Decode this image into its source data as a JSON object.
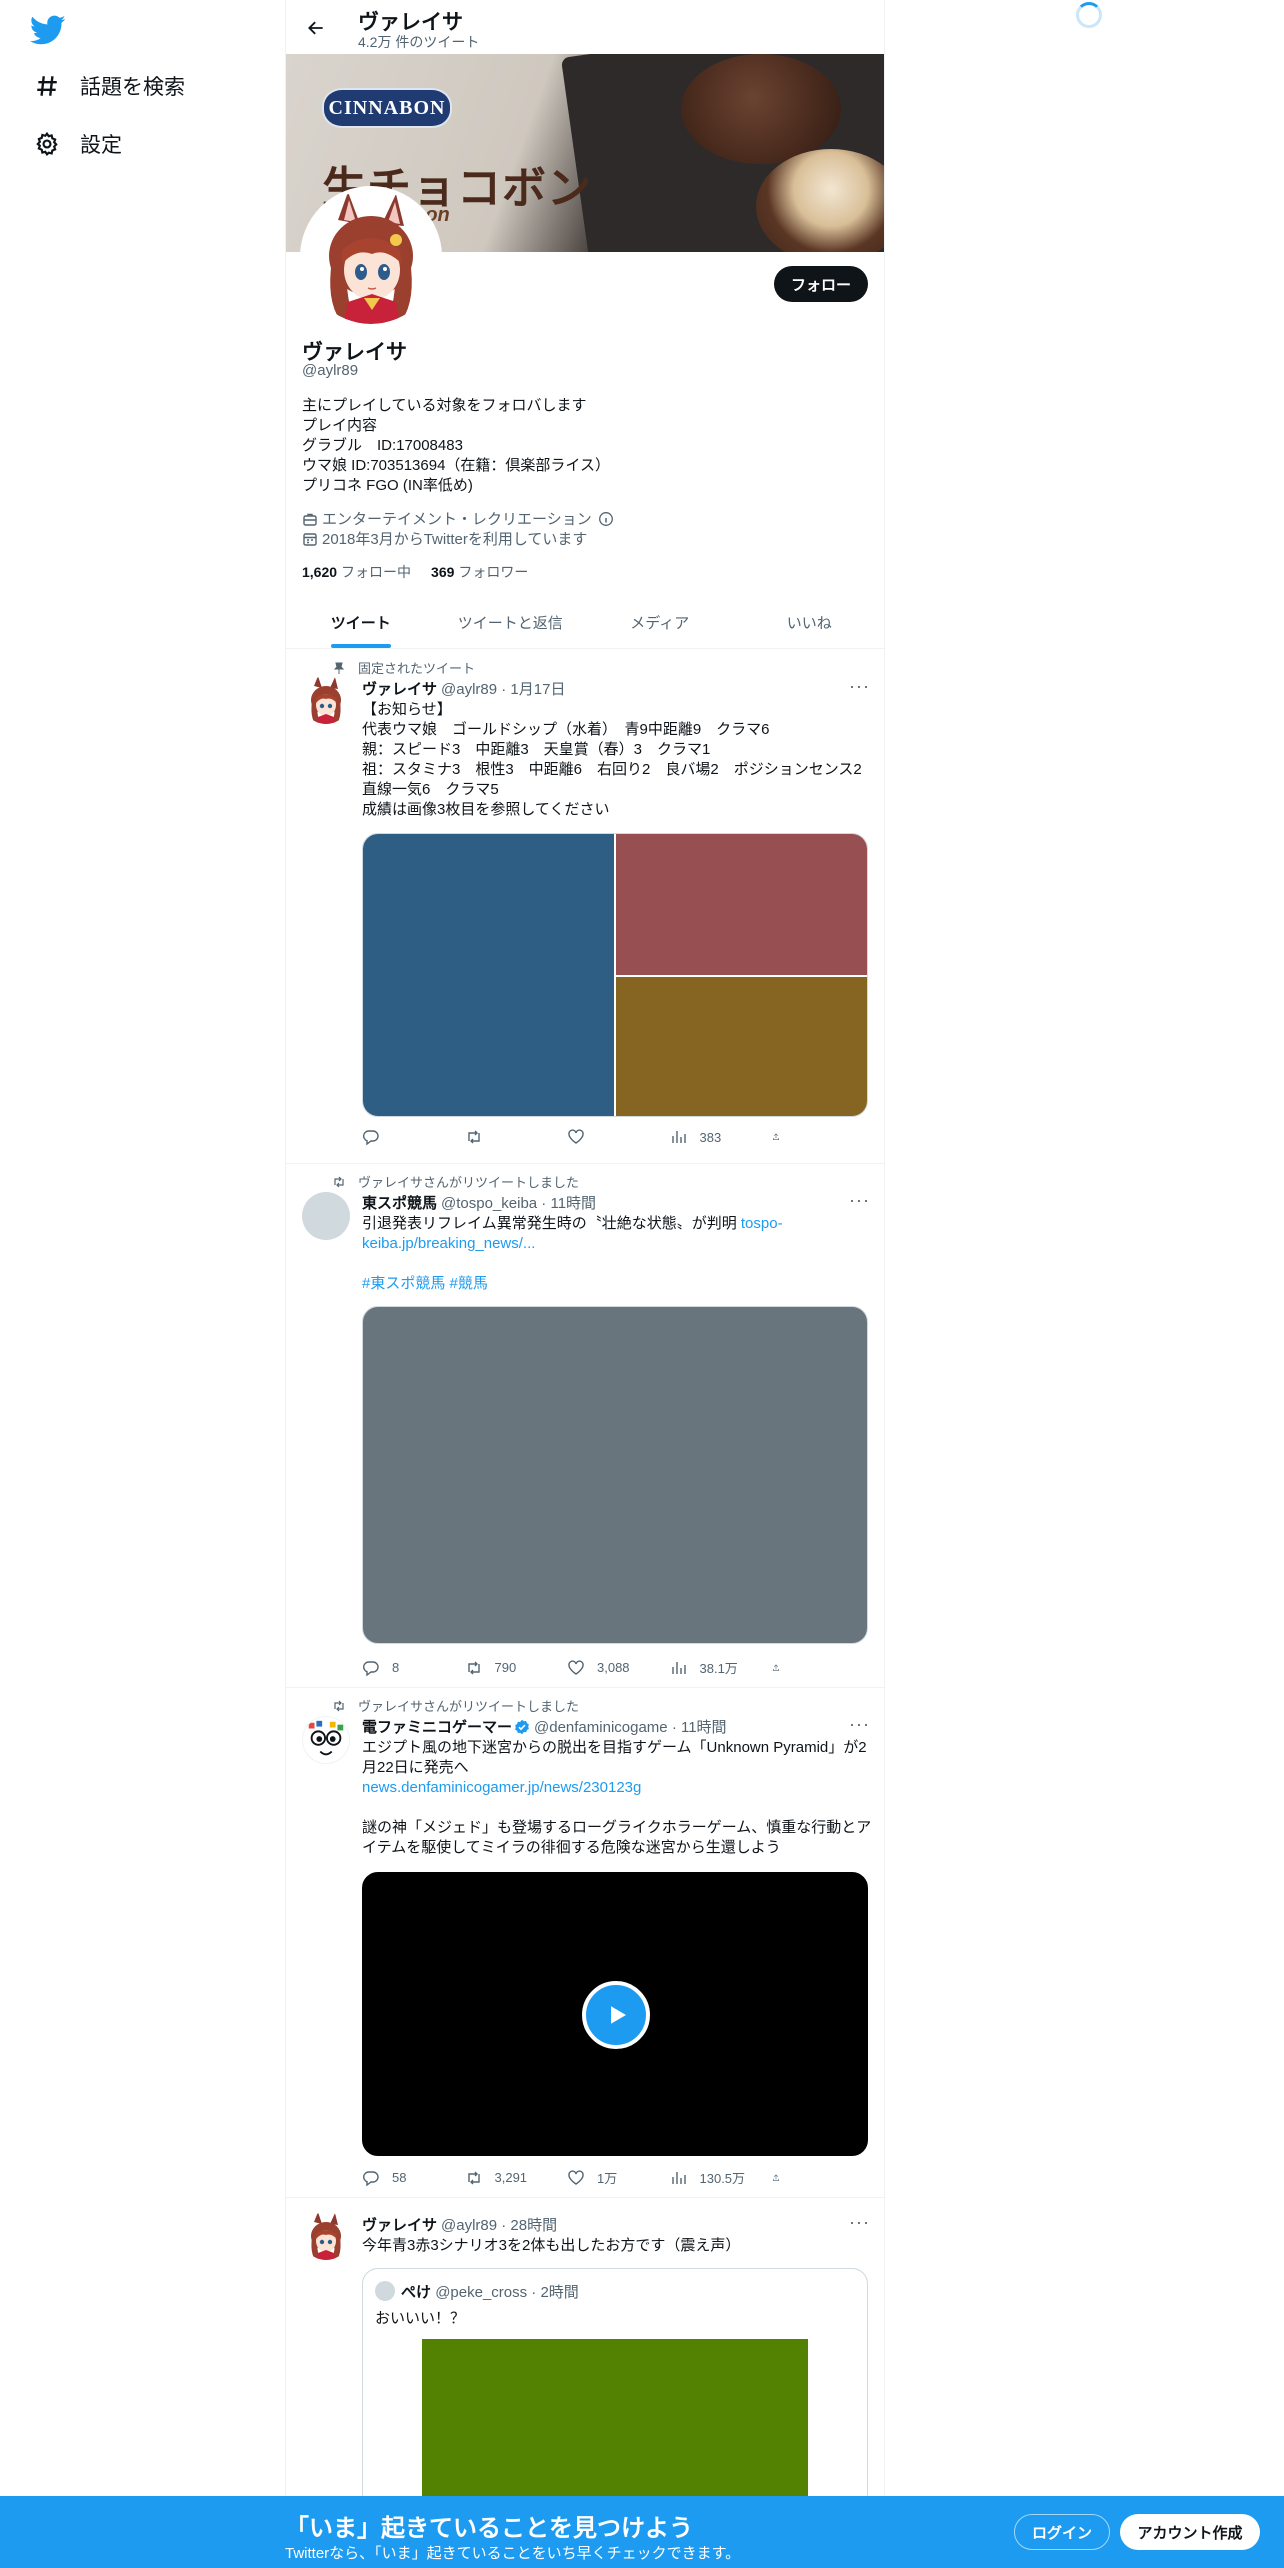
{
  "nav": {
    "explore_label": "話題を検索",
    "settings_label": "設定"
  },
  "header": {
    "title": "ヴァレイサ",
    "tweet_count": "4.2万 件のツイート"
  },
  "banner": {
    "brand": "CINNABON",
    "headline": "生チョコボン",
    "subline": "…abon"
  },
  "profile": {
    "follow_label": "フォロー",
    "name": "ヴァレイサ",
    "handle": "@aylr89",
    "bio": "主にプレイしている対象をフォロバします\nプレイ内容\nグラブル　ID:17008483\nウマ娘 ID:703513694（在籍：倶楽部ライス）\nプリコネ FGO (IN率低め)",
    "category": "エンターテイメント・レクリエーション",
    "joined": "2018年3月からTwitterを利用しています",
    "following_count": "1,620",
    "following_label": "フォロー中",
    "followers_count": "369",
    "followers_label": "フォロワー"
  },
  "tabs": [
    "ツイート",
    "ツイートと返信",
    "メディア",
    "いいね"
  ],
  "tweets": [
    {
      "context": "固定されたツイート",
      "name": "ヴァレイサ",
      "handle_time": "@aylr89 · 1月17日",
      "text": "【お知らせ】\n代表ウマ娘　ゴールドシップ（水着）　青9中距離9　クラマ6\n親：スピード3　中距離3　天皇賞（春）3　クラマ1\n祖：スタミナ3　根性3　中距離6　右回り2　良バ場2　ポジションセンス2\n直線一気6　クラマ5\n成績は画像3枚目を参照してください",
      "media_colors": [
        "#2f5e85",
        "#984f52",
        "#866421"
      ],
      "reply": "",
      "retweet": "",
      "like": "",
      "views": "383"
    },
    {
      "context": "ヴァレイサさんがリツイートしました",
      "name": "東スポ競馬",
      "handle_time": "@tospo_keiba · 11時間",
      "text_a": "引退発表リフレイム異常発生時の〝壮絶な状態〟が判明 ",
      "link": "tospo-keiba.jp/breaking_news/...",
      "hashtags": "#東スポ競馬 #競馬",
      "media_color": "#68757d",
      "reply": "8",
      "retweet": "790",
      "like": "3,088",
      "views": "38.1万"
    },
    {
      "context": "ヴァレイサさんがリツイートしました",
      "name": "電ファミニコゲーマー",
      "handle_time": "@denfaminicogame · 11時間",
      "text_a": "エジプト風の地下迷宮からの脱出を目指すゲーム「Unknown Pyramid」が2月22日に発売へ",
      "link": "news.denfaminicogamer.jp/news/230123g",
      "text_b": "謎の神「メジェド」も登場するローグライクホラーゲーム、慎重な行動とアイテムを駆使してミイラの徘徊する危険な迷宮から生還しよう",
      "reply": "58",
      "retweet": "3,291",
      "like": "1万",
      "views": "130.5万"
    },
    {
      "name": "ヴァレイサ",
      "handle_time": "@aylr89 · 28時間",
      "text": "今年青3赤3シナリオ3を2体も出したお方です（震え声）",
      "quote_name": "ぺけ",
      "quote_handle_time": "@peke_cross · 2時間",
      "quote_text": "おいいい！？",
      "quote_media_color": "#538203"
    }
  ],
  "bottom_bar": {
    "title": "「いま」起きていることを見つけよう",
    "subtitle": "Twitterなら、「いま」起きていることをいち早くチェックできます。",
    "login_label": "ログイン",
    "signup_label": "アカウント作成"
  },
  "colors": {
    "accent": "#1d9bf0",
    "text": "#0f1419",
    "secondary": "#536471"
  }
}
